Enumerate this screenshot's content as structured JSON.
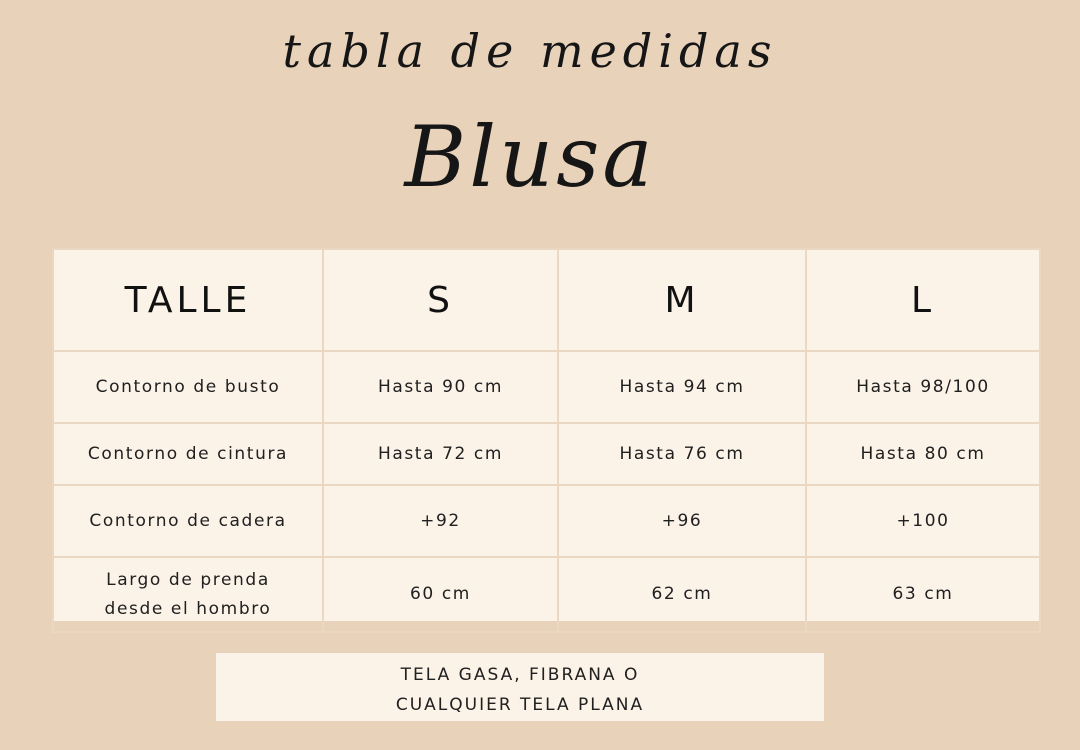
{
  "header": {
    "subtitle": "tabla de medidas",
    "title": "Blusa"
  },
  "table": {
    "columns": [
      "TALLE",
      "S",
      "M",
      "L"
    ],
    "rows": [
      {
        "label": [
          "Contorno de busto"
        ],
        "values": [
          "Hasta 90 cm",
          "Hasta 94 cm",
          "Hasta 98/100"
        ]
      },
      {
        "label": [
          "Contorno de cintura"
        ],
        "values": [
          "Hasta 72 cm",
          "Hasta 76 cm",
          "Hasta 80 cm"
        ]
      },
      {
        "label": [
          "Contorno de cadera"
        ],
        "values": [
          "+92",
          "+96",
          "+100"
        ]
      },
      {
        "label": [
          "Largo de prenda",
          "desde el hombro"
        ],
        "values": [
          "60 cm",
          "62 cm",
          "63 cm"
        ]
      }
    ]
  },
  "note": {
    "lines": [
      "TELA GASA, FIBRANA O",
      "CUALQUIER TELA PLANA"
    ]
  },
  "colors": {
    "background": "#e8d2b9",
    "panel": "#fbf2e8",
    "grid": "#ead8c3",
    "text": "#1c1c1c"
  }
}
